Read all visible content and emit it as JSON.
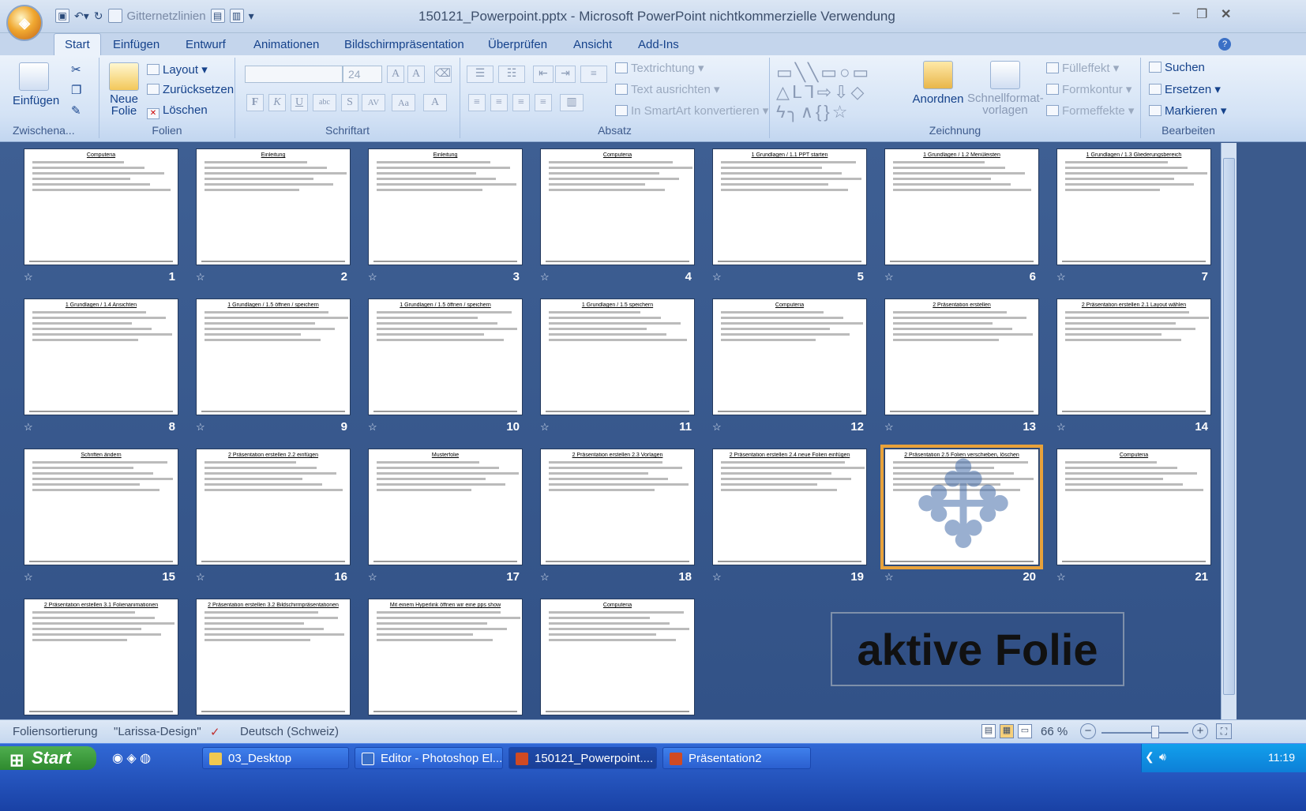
{
  "window": {
    "title": "150121_Powerpoint.pptx - Microsoft PowerPoint nichtkommerzielle Verwendung"
  },
  "qat": {
    "checkbox_label": "Gitternetzlinien"
  },
  "tabs": [
    "Start",
    "Einfügen",
    "Entwurf",
    "Animationen",
    "Bildschirmpräsentation",
    "Überprüfen",
    "Ansicht",
    "Add-Ins"
  ],
  "ribbon": {
    "clipboard": {
      "paste": "Einfügen",
      "group": "Zwischena..."
    },
    "slides": {
      "new_slide_1": "Neue",
      "new_slide_2": "Folie",
      "layout": "Layout",
      "reset": "Zurücksetzen",
      "delete": "Löschen",
      "group": "Folien"
    },
    "font": {
      "size": "24",
      "group": "Schriftart"
    },
    "paragraph": {
      "text_direction": "Textrichtung",
      "align_text": "Text ausrichten",
      "smartart": "In SmartArt konvertieren",
      "group": "Absatz"
    },
    "drawing": {
      "arrange": "Anordnen",
      "quick_styles_1": "Schnellformat-",
      "quick_styles_2": "vorlagen",
      "fill": "Fülleffekt",
      "outline": "Formkontur",
      "effects": "Formeffekte",
      "group": "Zeichnung"
    },
    "editing": {
      "find": "Suchen",
      "replace": "Ersetzen",
      "select": "Markieren",
      "group": "Bearbeiten"
    }
  },
  "slides": [
    {
      "num": "1",
      "title": "Computeria"
    },
    {
      "num": "2",
      "title": "Einleitung"
    },
    {
      "num": "3",
      "title": "Einleitung"
    },
    {
      "num": "4",
      "title": "Computeria"
    },
    {
      "num": "5",
      "title": "1 Grundlagen / 1.1 PPT starten"
    },
    {
      "num": "6",
      "title": "1 Grundlagen / 1.2 Menüleisten"
    },
    {
      "num": "7",
      "title": "1 Grundlagen / 1.3 Gliederungsbereich"
    },
    {
      "num": "8",
      "title": "1 Grundlagen / 1.4 Ansichten"
    },
    {
      "num": "9",
      "title": "1 Grundlagen / 1.5 öffnen / speichern"
    },
    {
      "num": "10",
      "title": "1 Grundlagen / 1.5 öffnen / speichern"
    },
    {
      "num": "11",
      "title": "1 Grundlagen / 1.5 speichern"
    },
    {
      "num": "12",
      "title": "Computeria"
    },
    {
      "num": "13",
      "title": "2 Präsentation erstellen"
    },
    {
      "num": "14",
      "title": "2 Präsentation erstellen 2.1 Layout wählen"
    },
    {
      "num": "15",
      "title": "Schriften ändern"
    },
    {
      "num": "16",
      "title": "2 Präsentation erstellen 2.2 einfügen"
    },
    {
      "num": "17",
      "title": "Musterfolie"
    },
    {
      "num": "18",
      "title": "2 Präsentation erstellen 2.3 Vorlagen"
    },
    {
      "num": "19",
      "title": "2 Präsentation erstellen 2.4 neue Folien einfügen"
    },
    {
      "num": "20",
      "title": "2 Präsentation 2.5 Folien verschieben, löschen"
    },
    {
      "num": "21",
      "title": "Computeria"
    },
    {
      "num": "",
      "title": "2 Präsentation erstellen 3.1 Folienanimationen"
    },
    {
      "num": "",
      "title": "2 Präsentation erstellen 3.2 Bildschirmpräsentationen"
    },
    {
      "num": "",
      "title": "Mit einem Hyperlink öffnen wir eine pps show"
    },
    {
      "num": "",
      "title": "Computeria"
    }
  ],
  "callout": "aktive Folie",
  "status": {
    "view": "Foliensortierung",
    "theme": "\"Larissa-Design\"",
    "language": "Deutsch (Schweiz)",
    "zoom": "66 %"
  },
  "taskbar": {
    "start": "Start",
    "items": [
      "03_Desktop",
      "Editor - Photoshop El...",
      "150121_Powerpoint....",
      "Präsentation2"
    ],
    "clock": "11:19"
  }
}
